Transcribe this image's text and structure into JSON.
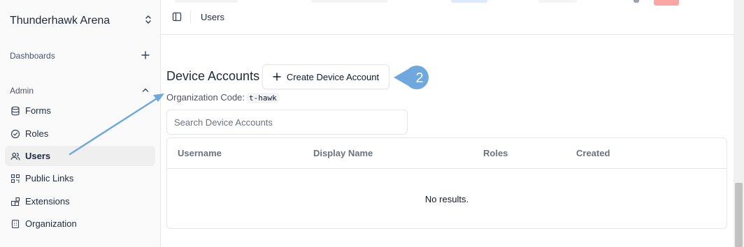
{
  "sidebar": {
    "org_name": "Thunderhawk Arena",
    "sections": {
      "dashboards": "Dashboards",
      "admin": "Admin"
    },
    "items": [
      {
        "label": "Forms",
        "icon": "database-icon"
      },
      {
        "label": "Roles",
        "icon": "circle-check-icon"
      },
      {
        "label": "Users",
        "icon": "users-icon",
        "active": true
      },
      {
        "label": "Public Links",
        "icon": "qr-code-icon"
      },
      {
        "label": "Extensions",
        "icon": "blocks-icon"
      },
      {
        "label": "Organization",
        "icon": "building-icon"
      }
    ]
  },
  "header": {
    "breadcrumb": "Users"
  },
  "main": {
    "title": "Device Accounts",
    "create_label": "Create Device Account",
    "org_code_label": "Organization Code:",
    "org_code_value": "t-hawk",
    "search_placeholder": "Search Device Accounts",
    "columns": [
      "Username",
      "Display Name",
      "Roles",
      "Created"
    ],
    "empty_text": "No results."
  },
  "annotation": {
    "step_number": "2",
    "color": "#6fa8dc"
  }
}
